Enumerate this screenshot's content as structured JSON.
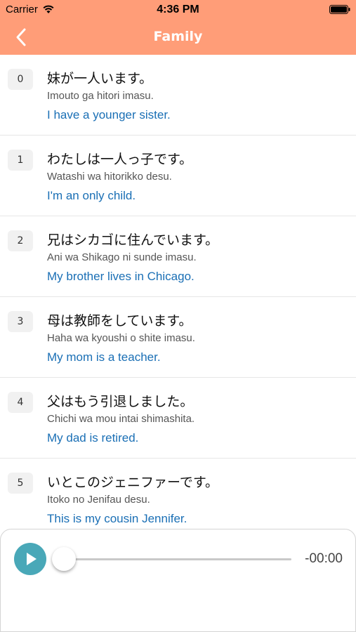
{
  "status_bar": {
    "carrier": "Carrier",
    "time": "4:36 PM"
  },
  "nav": {
    "title": "Family",
    "back_icon": "chevron-left-icon"
  },
  "colors": {
    "header": "#ff9d78",
    "english_text": "#1a6fb5",
    "play_button": "#49a8b8"
  },
  "phrases": [
    {
      "number": "0",
      "japanese": "妹が一人います。",
      "romaji": "Imouto ga hitori imasu.",
      "english": "I have a younger sister."
    },
    {
      "number": "1",
      "japanese": "わたしは一人っ子です。",
      "romaji": "Watashi wa hitorikko desu.",
      "english": "I'm an only child."
    },
    {
      "number": "2",
      "japanese": "兄はシカゴに住んでいます。",
      "romaji": "Ani wa Shikago ni sunde imasu.",
      "english": "My brother lives in Chicago."
    },
    {
      "number": "3",
      "japanese": "母は教師をしています。",
      "romaji": "Haha wa kyoushi o shite imasu.",
      "english": "My mom is a teacher."
    },
    {
      "number": "4",
      "japanese": "父はもう引退しました。",
      "romaji": "Chichi wa mou intai shimashita.",
      "english": "My dad is retired."
    },
    {
      "number": "5",
      "japanese": "いとこのジェニファーです。",
      "romaji": "Itoko no Jenifau desu.",
      "english": "This is my cousin Jennifer."
    }
  ],
  "player": {
    "play_icon": "play-icon",
    "remaining_time": "-00:00",
    "progress": 0
  }
}
